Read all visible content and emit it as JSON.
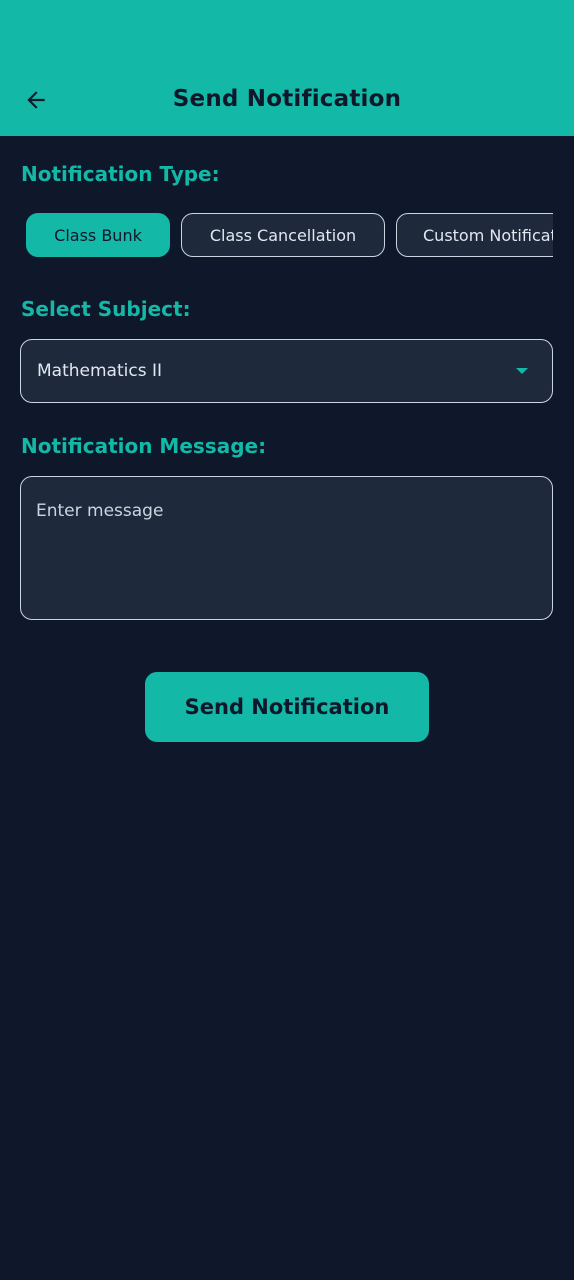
{
  "appbar": {
    "title": "Send Notification",
    "back_icon": "arrow-left-icon",
    "background_color": "#14b8a6"
  },
  "notification_type": {
    "label": "Notification Type:",
    "options": [
      {
        "label": "Class Bunk",
        "selected": true
      },
      {
        "label": "Class Cancellation",
        "selected": false
      },
      {
        "label": "Custom Notification",
        "selected": false
      }
    ]
  },
  "subject": {
    "label": "Select Subject:",
    "selected_value": "Mathematics II",
    "arrow_icon": "dropdown-arrow-icon"
  },
  "message": {
    "label": "Notification Message:",
    "placeholder": "Enter message",
    "value": ""
  },
  "submit": {
    "label": "Send Notification"
  },
  "colors": {
    "accent": "#14b8a6",
    "background": "#0f172a",
    "surface": "#1e293b",
    "border": "#cbd5e1"
  }
}
